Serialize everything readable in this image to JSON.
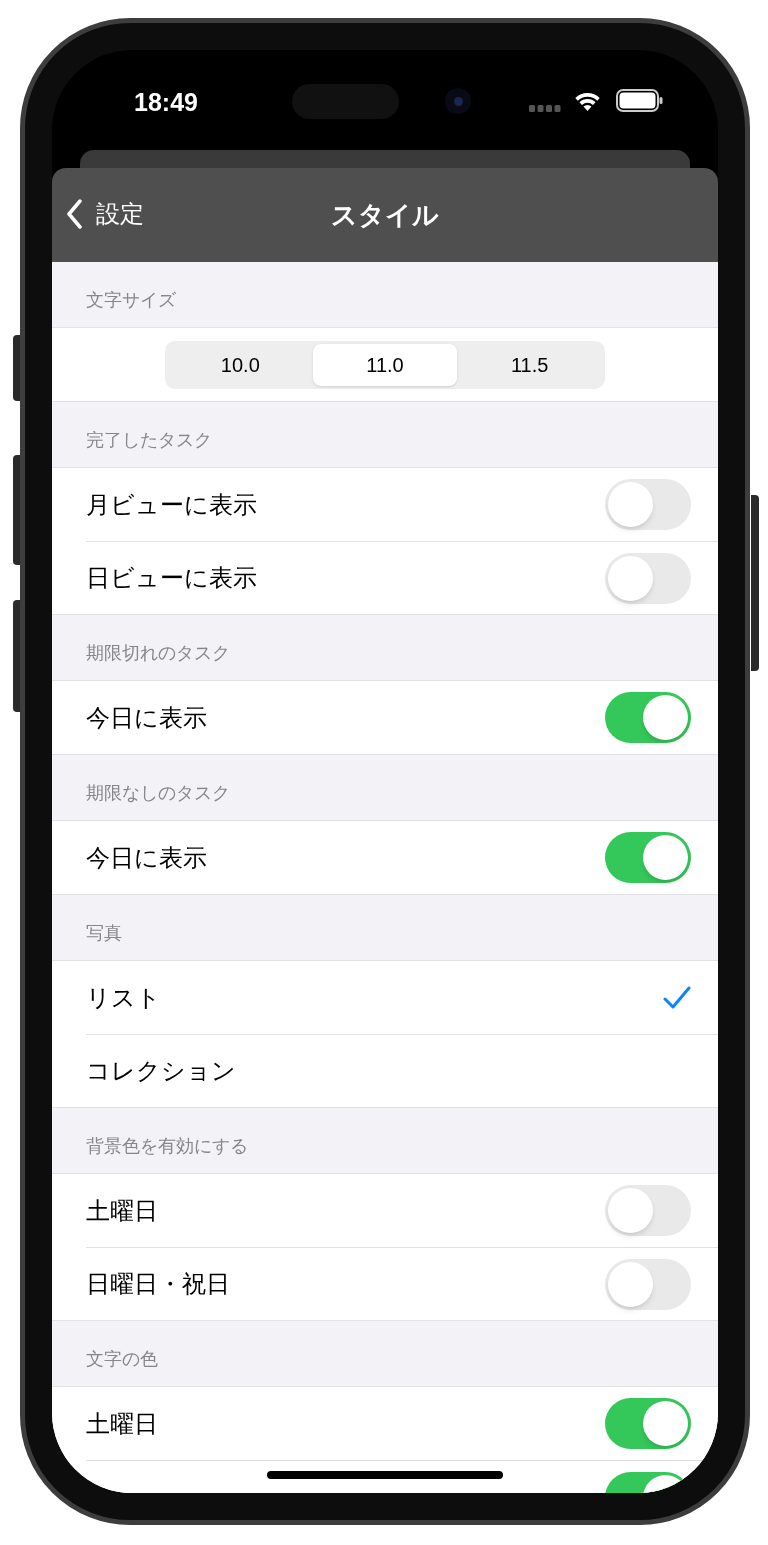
{
  "status_bar": {
    "time": "18:49"
  },
  "nav": {
    "back_label": "設定",
    "title": "スタイル"
  },
  "sections": [
    {
      "header": "文字サイズ",
      "kind": "segmented",
      "options": [
        {
          "label": "10.0",
          "selected": false
        },
        {
          "label": "11.0",
          "selected": true
        },
        {
          "label": "11.5",
          "selected": false
        }
      ]
    },
    {
      "header": "完了したタスク",
      "kind": "list",
      "rows": [
        {
          "kind": "toggle",
          "label": "月ビューに表示",
          "on": false
        },
        {
          "kind": "toggle",
          "label": "日ビューに表示",
          "on": false
        }
      ]
    },
    {
      "header": "期限切れのタスク",
      "kind": "list",
      "rows": [
        {
          "kind": "toggle",
          "label": "今日に表示",
          "on": true
        }
      ]
    },
    {
      "header": "期限なしのタスク",
      "kind": "list",
      "rows": [
        {
          "kind": "toggle",
          "label": "今日に表示",
          "on": true
        }
      ]
    },
    {
      "header": "写真",
      "kind": "list",
      "rows": [
        {
          "kind": "choice",
          "label": "リスト",
          "selected": true
        },
        {
          "kind": "choice",
          "label": "コレクション",
          "selected": false
        }
      ]
    },
    {
      "header": "背景色を有効にする",
      "kind": "list",
      "rows": [
        {
          "kind": "toggle",
          "label": "土曜日",
          "on": false
        },
        {
          "kind": "toggle",
          "label": "日曜日・祝日",
          "on": false
        }
      ]
    },
    {
      "header": "文字の色",
      "kind": "list",
      "rows": [
        {
          "kind": "toggle",
          "label": "土曜日",
          "on": true
        },
        {
          "kind": "toggle",
          "on": true
        }
      ]
    }
  ]
}
